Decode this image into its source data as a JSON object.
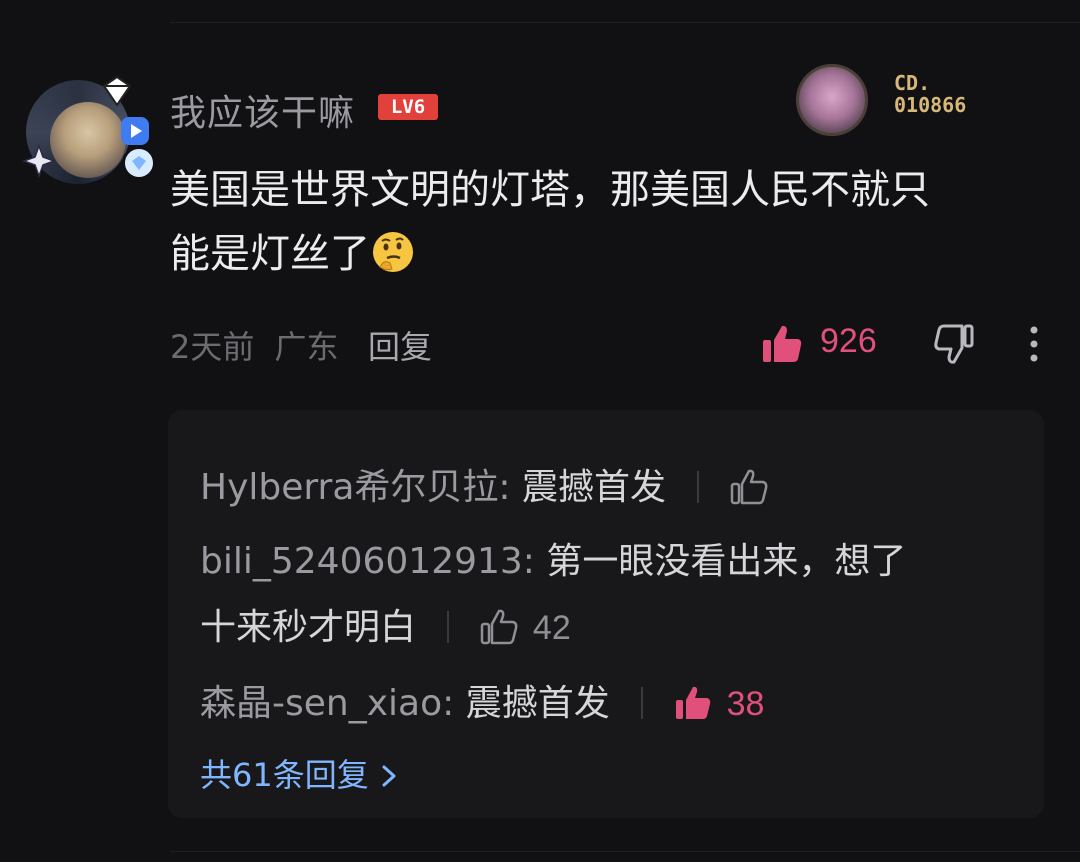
{
  "comment": {
    "username": "我应该干嘛",
    "level": "LV6",
    "decoration_code": [
      "CD.",
      "010866"
    ],
    "text_line1": "美国是世界文明的灯塔，那美国人民不就只",
    "text_line2": "能是灯丝了",
    "emoji_icon": "thinking-face-emoji",
    "time": "2天前",
    "location": "广东",
    "reply_label": "回复",
    "like_count": "926",
    "colors": {
      "accent_pink": "#e0507a",
      "level_red": "#e2403a",
      "link_blue": "#7fb6ff"
    }
  },
  "replies": [
    {
      "user": "Hylberra希尔贝拉:",
      "content": "震撼首发",
      "likes": "",
      "liked": false
    },
    {
      "user": "bili_52406012913:",
      "content_line1": "第一眼没看出来，想了",
      "content_line2": "十来秒才明白",
      "likes": "42",
      "liked": false
    },
    {
      "user": "森晶-sen_xiao:",
      "content": "震撼首发",
      "likes": "38",
      "liked": true
    }
  ],
  "view_all": "共61条回复"
}
